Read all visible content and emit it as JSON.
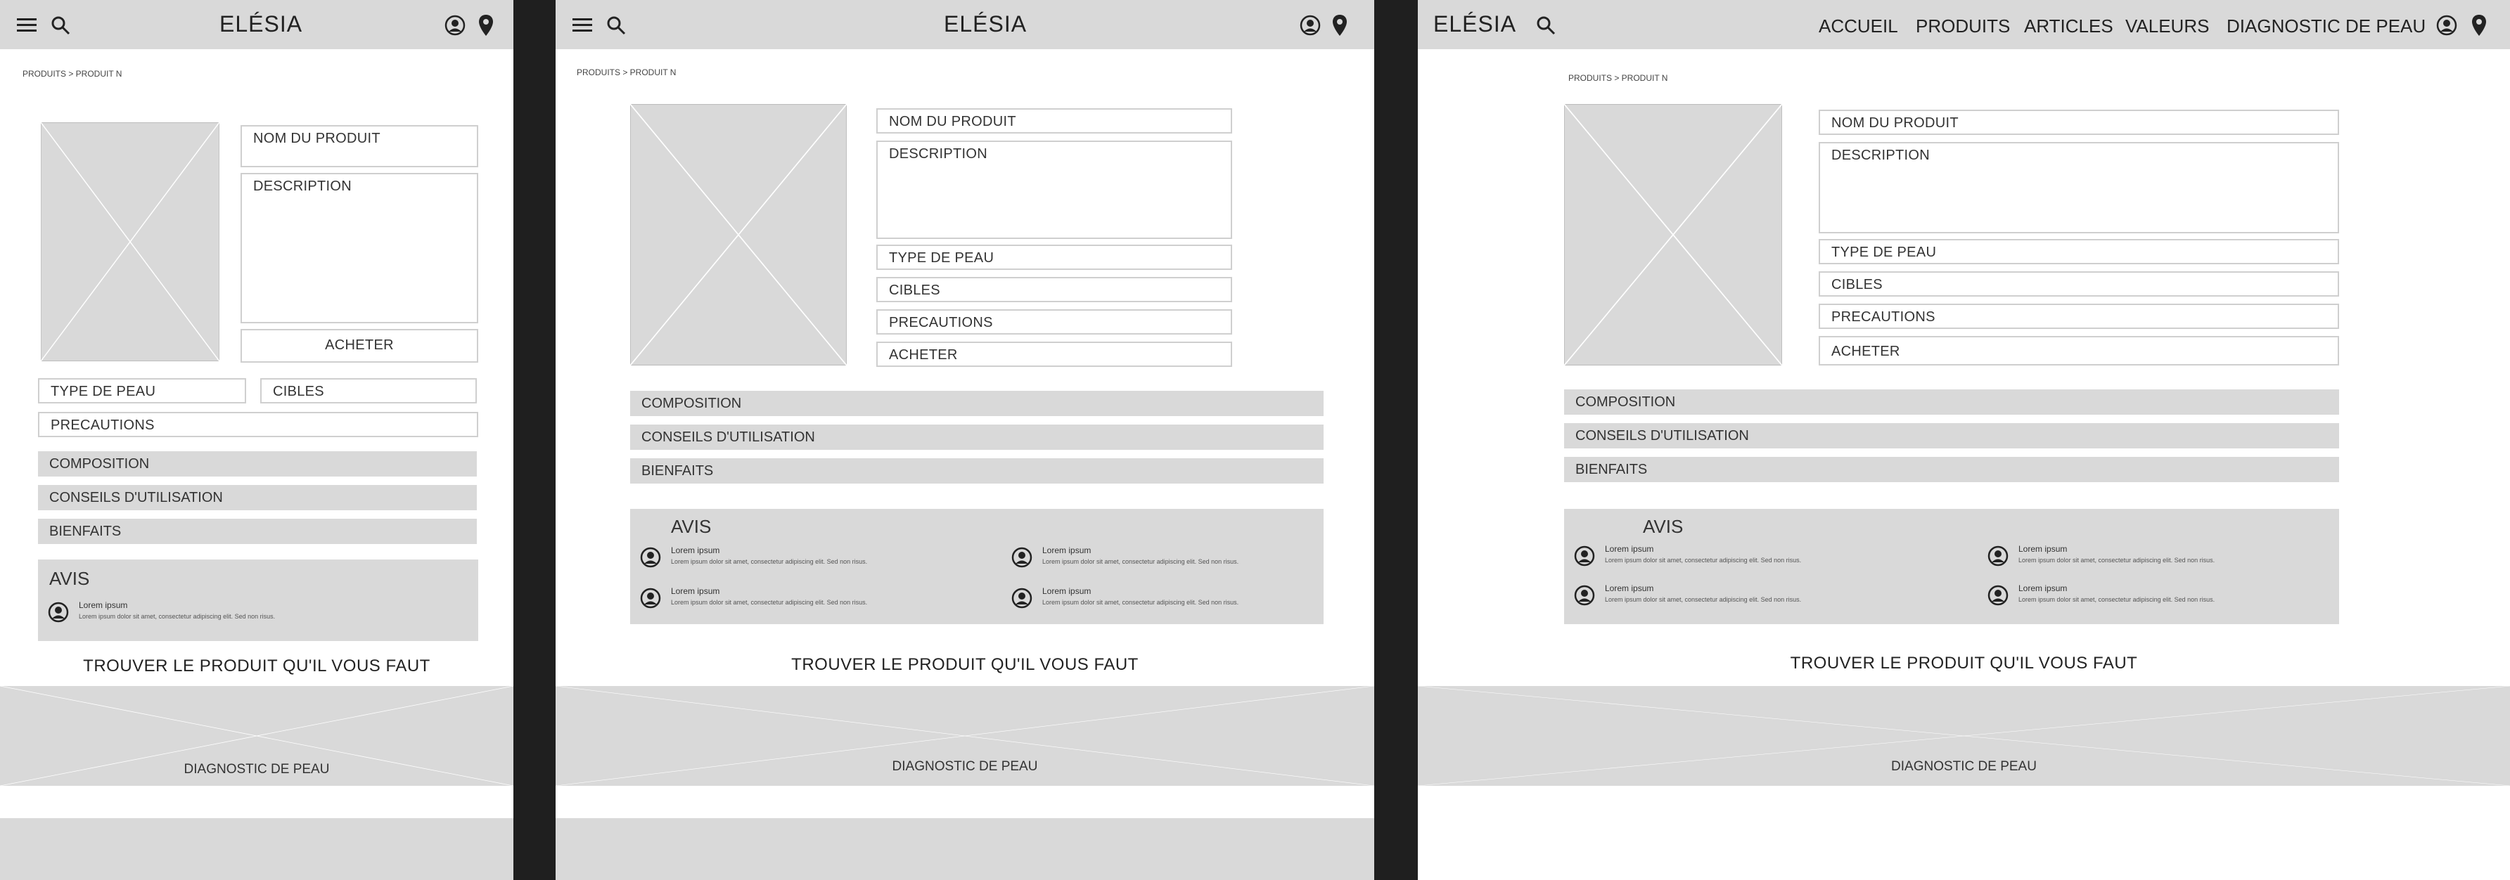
{
  "brand": "ELÉSIA",
  "breadcrumb": "PRODUITS > PRODUIT N",
  "nav": [
    "ACCUEIL",
    "PRODUITS",
    "ARTICLES",
    "VALEURS",
    "DIAGNOSTIC DE PEAU"
  ],
  "product": {
    "name": "NOM DU PRODUIT",
    "description": "DESCRIPTION",
    "buy": "ACHETER",
    "skin_type": "TYPE DE PEAU",
    "targets": "CIBLES",
    "precautions": "PRECAUTIONS"
  },
  "sections": {
    "composition": "COMPOSITION",
    "usage": "CONSEILS D'UTILISATION",
    "benefits": "BIENFAITS"
  },
  "reviews": {
    "title": "AVIS",
    "name": "Lorem ipsum",
    "text": "Lorem ipsum dolor sit amet, consectetur adipiscing elit. Sed non risus."
  },
  "find_product": "TROUVER LE PRODUIT QU'IL VOUS FAUT",
  "diagnostic": "DIAGNOSTIC DE PEAU",
  "icons": [
    "menu-icon",
    "search-icon",
    "account-icon",
    "location-icon",
    "image-placeholder-icon",
    "avatar-icon"
  ]
}
